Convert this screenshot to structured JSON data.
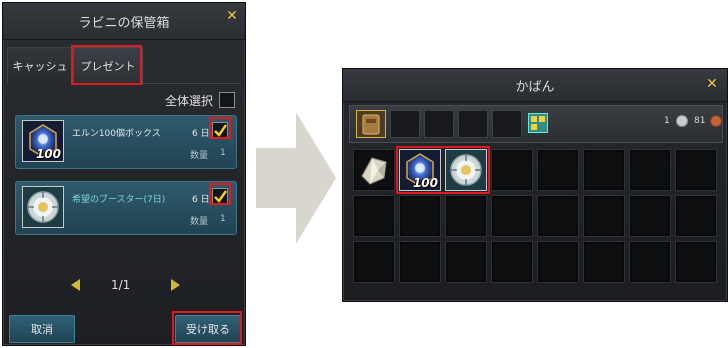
{
  "storage": {
    "title": "ラビニの保管箱",
    "tabs": [
      {
        "label": "キャッシュ"
      },
      {
        "label": "プレゼント"
      }
    ],
    "select_all_label": "全体選択",
    "items": [
      {
        "name": "エルン100個ボックス",
        "days": "6 日",
        "qty_label": "数量",
        "qty": "1",
        "count_badge": "100"
      },
      {
        "name": "希望のブースター(7日)",
        "days": "6 日",
        "qty_label": "数量",
        "qty": "1"
      }
    ],
    "page": "1/1",
    "cancel_label": "取消",
    "receive_label": "受け取る"
  },
  "bag": {
    "title": "かばん",
    "currency": [
      {
        "value": "1",
        "color": "#c9ccd0"
      },
      {
        "value": "81",
        "color": "#c0643a"
      }
    ],
    "items": [
      {
        "icon": "crystal-fragment-icon"
      },
      {
        "icon": "ern-box-icon",
        "count_badge": "100"
      },
      {
        "icon": "hope-booster-icon"
      }
    ]
  },
  "colors": {
    "highlight_frame": "#e2191c",
    "panel_teal": "#2f5b6d",
    "accent_gold": "#d3b836"
  }
}
